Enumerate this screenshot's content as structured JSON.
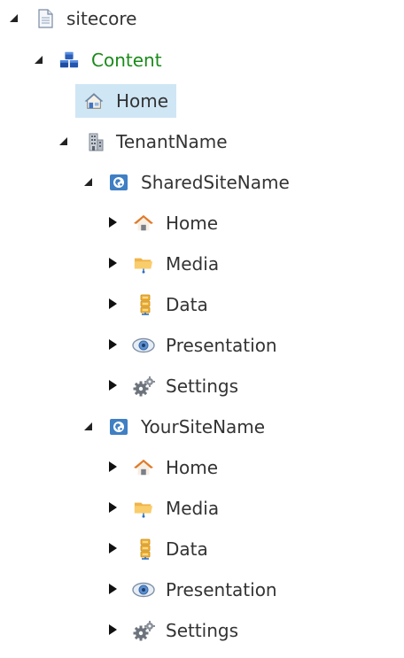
{
  "tree": {
    "root": {
      "label": "sitecore",
      "icon": "page-icon",
      "expanded": true
    },
    "content": {
      "label": "Content",
      "icon": "content-cubes-icon",
      "expanded": true
    },
    "home_selected": {
      "label": "Home",
      "icon": "home-house-icon",
      "selected": true
    },
    "tenant": {
      "label": "TenantName",
      "icon": "building-icon",
      "expanded": true
    },
    "shared_site": {
      "label": "SharedSiteName",
      "icon": "site-globe-icon",
      "expanded": true,
      "children": [
        {
          "label": "Home",
          "icon": "home-icon",
          "expanded": false
        },
        {
          "label": "Media",
          "icon": "media-folder-icon",
          "expanded": false
        },
        {
          "label": "Data",
          "icon": "data-icon",
          "expanded": false
        },
        {
          "label": "Presentation",
          "icon": "eye-icon",
          "expanded": false
        },
        {
          "label": "Settings",
          "icon": "gears-icon",
          "expanded": false
        }
      ]
    },
    "your_site": {
      "label": "YourSiteName",
      "icon": "site-globe-icon",
      "expanded": true,
      "children": [
        {
          "label": "Home",
          "icon": "home-icon",
          "expanded": false
        },
        {
          "label": "Media",
          "icon": "media-folder-icon",
          "expanded": false
        },
        {
          "label": "Data",
          "icon": "data-icon",
          "expanded": false
        },
        {
          "label": "Presentation",
          "icon": "eye-icon",
          "expanded": false
        },
        {
          "label": "Settings",
          "icon": "gears-icon",
          "expanded": false
        }
      ]
    }
  },
  "colors": {
    "text": "#333333",
    "content_green": "#1a8a1a",
    "selection": "#cfe6f5"
  }
}
